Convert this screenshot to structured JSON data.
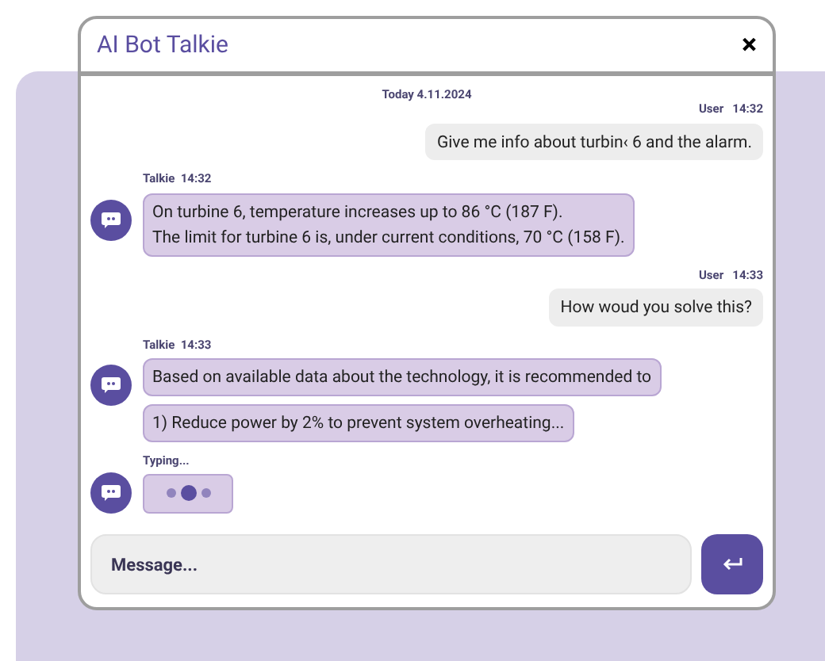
{
  "window": {
    "title": "AI Bot Talkie",
    "close": "×"
  },
  "date": "Today 4.11.2024",
  "messages": [
    {
      "kind": "user",
      "sender": "User",
      "time": "14:32",
      "bubbles": [
        "Give me info about turbin‹ 6 and the alarm."
      ]
    },
    {
      "kind": "bot",
      "sender": "Talkie",
      "time": "14:32",
      "bubbles": [
        "On turbine 6, temperature increases up to 86 °C (187 F).\nThe limit for turbine 6 is, under current conditions, 70 °C (158 F)."
      ]
    },
    {
      "kind": "user",
      "sender": "User",
      "time": "14:33",
      "bubbles": [
        "How woud you solve this?"
      ]
    },
    {
      "kind": "bot",
      "sender": "Talkie",
      "time": "14:33",
      "bubbles": [
        "Based on available data about the technology, it is recommended to",
        "1) Reduce power by 2% to prevent system overheating..."
      ]
    }
  ],
  "typing": {
    "label": "Typing...",
    "dots": [
      {
        "selected": false
      },
      {
        "selected": true
      },
      {
        "selected": false
      }
    ]
  },
  "composer": {
    "placeholder": "Message..."
  }
}
